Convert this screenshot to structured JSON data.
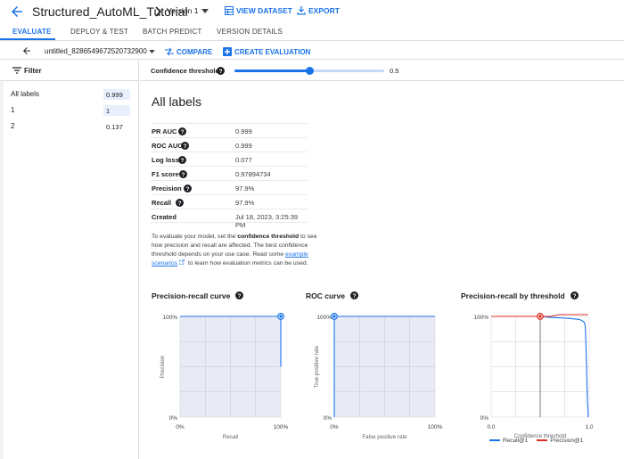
{
  "header": {
    "title": "Structured_AutoML_Tutorial",
    "version": "Version 1",
    "view_dataset": "VIEW DATASET",
    "export": "EXPORT"
  },
  "tabs": [
    {
      "label": "EVALUATE",
      "active": true
    },
    {
      "label": "DEPLOY & TEST"
    },
    {
      "label": "BATCH PREDICT"
    },
    {
      "label": "VERSION DETAILS"
    }
  ],
  "model_row": {
    "model": "untitled_8286549672520732900",
    "compare": "COMPARE",
    "create_evaluation": "CREATE EVALUATION"
  },
  "sidebar": {
    "filter": "Filter",
    "labels": [
      {
        "name": "All labels",
        "value": "0.999"
      },
      {
        "name": "1",
        "value": "1"
      },
      {
        "name": "2",
        "value": "0.137"
      }
    ]
  },
  "threshold": {
    "label": "Confidence threshold",
    "value": 0.5,
    "value_text": "0.5"
  },
  "main": {
    "title": "All labels",
    "metrics": [
      {
        "name": "PR AUC",
        "value": "0.999",
        "help": true
      },
      {
        "name": "ROC AUC",
        "value": "0.999",
        "help": true
      },
      {
        "name": "Log loss",
        "value": "0.077",
        "help": true
      },
      {
        "name": "F1 score",
        "value": "0.97894734",
        "help": true
      },
      {
        "name": "Precision",
        "value": "97.9%",
        "help": true
      },
      {
        "name": "Recall",
        "value": "97.9%",
        "help": true
      },
      {
        "name": "Created",
        "value": "Jul 18, 2023, 3:25:39 PM",
        "help": false
      }
    ],
    "description": {
      "p1": "To evaluate your model, set the ",
      "bold": "confidence threshold",
      "p2": " to see how precision and recall are affected. The best confidence threshold depends on your use case. Read some ",
      "link": "example scenarios",
      "p3": " to learn how evaluation metrics can be used."
    }
  },
  "chart_data": [
    {
      "type": "line",
      "title": "Precision-recall curve",
      "xlabel": "Recall",
      "ylabel": "Precision",
      "x_ticks": [
        "0%",
        "100%"
      ],
      "y_ticks": [
        "0%",
        "100%"
      ],
      "xlim": [
        0,
        1
      ],
      "ylim": [
        0,
        1
      ],
      "grid": true,
      "x": [
        0,
        1.0,
        1.0
      ],
      "y": [
        1.0,
        1.0,
        0.5
      ],
      "point": {
        "x": 1.0,
        "y": 1.0
      },
      "color": "#1a73e8"
    },
    {
      "type": "line",
      "title": "ROC curve",
      "xlabel": "False positive rate",
      "ylabel": "True positive rate",
      "x_ticks": [
        "0%",
        "100%"
      ],
      "y_ticks": [
        "0%",
        "100%"
      ],
      "xlim": [
        0,
        1
      ],
      "ylim": [
        0,
        1
      ],
      "grid": true,
      "x": [
        0,
        0,
        1.0
      ],
      "y": [
        0,
        1.0,
        1.0
      ],
      "point": {
        "x": 0,
        "y": 1.0
      },
      "color": "#1a73e8"
    },
    {
      "type": "line",
      "title": "Precision-recall by threshold",
      "xlabel": "Confidence threshold",
      "x_ticks": [
        "0.0",
        "1.0"
      ],
      "y_ticks": [
        "0%",
        "100%"
      ],
      "xlim": [
        0,
        1
      ],
      "ylim": [
        0,
        1
      ],
      "grid": true,
      "legend": "bottom",
      "threshold_marker": 0.5,
      "series": [
        {
          "name": "Recall@1",
          "color": "#1a73e8",
          "x": [
            0,
            0.5,
            0.6,
            0.8,
            0.9,
            0.92,
            0.94,
            0.95,
            0.96,
            0.97,
            0.98,
            0.99
          ],
          "y": [
            1.0,
            1.0,
            0.99,
            0.98,
            0.97,
            0.96,
            0.95,
            0.94,
            0.9,
            0.6,
            0.2,
            0.0
          ]
        },
        {
          "name": "Precision@1",
          "color": "#d93025",
          "x": [
            0,
            0.5,
            0.6,
            0.7,
            0.99
          ],
          "y": [
            1.0,
            1.0,
            1.0,
            1.01,
            1.01
          ]
        }
      ]
    }
  ]
}
